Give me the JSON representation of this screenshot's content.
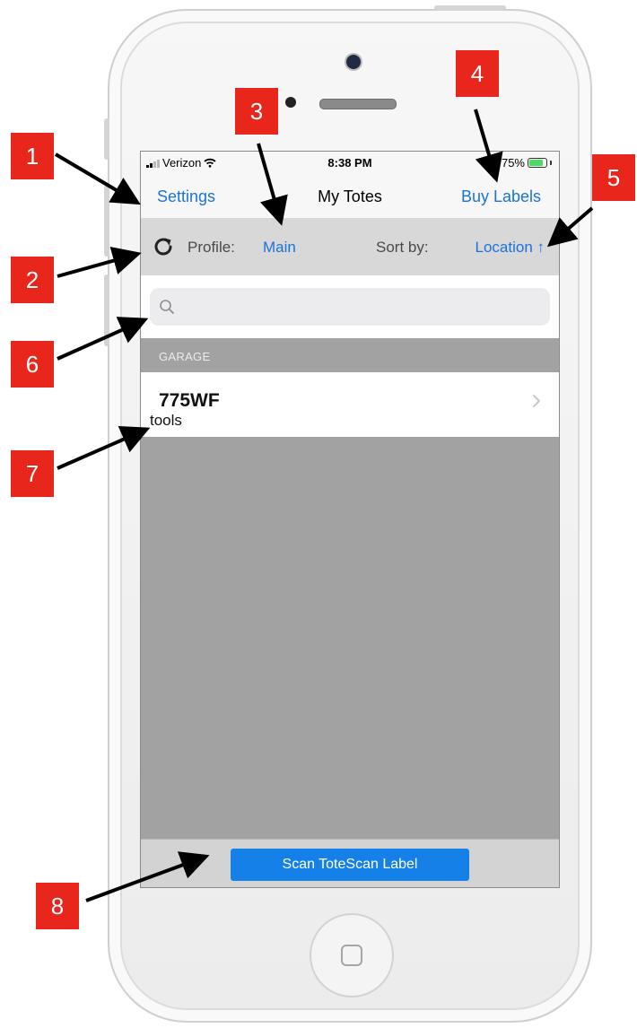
{
  "status_bar": {
    "carrier": "Verizon",
    "time": "8:38 PM",
    "battery": "75%"
  },
  "nav": {
    "left_label": "Settings",
    "title": "My Totes",
    "right_label": "Buy Labels"
  },
  "profile_bar": {
    "profile_label": "Profile:",
    "profile_value": "Main",
    "sort_label": "Sort by:",
    "sort_value": "Location ↑"
  },
  "search": {
    "placeholder": "",
    "value": ""
  },
  "sections": [
    {
      "header": "GARAGE",
      "rows": [
        {
          "code": "775WF",
          "description": "tools"
        }
      ]
    }
  ],
  "bottom": {
    "scan_button_label": "Scan ToteScan Label"
  },
  "callouts": [
    "1",
    "2",
    "3",
    "4",
    "5",
    "6",
    "7",
    "8"
  ],
  "colors": {
    "accent": "#1a73d9",
    "callout": "#e8261b",
    "scan_button": "#1580e8",
    "list_background": "#a2a2a2"
  },
  "icons": [
    "refresh-icon",
    "search-icon",
    "chevron-right-icon",
    "wifi-icon",
    "battery-icon",
    "signal-icon"
  ]
}
